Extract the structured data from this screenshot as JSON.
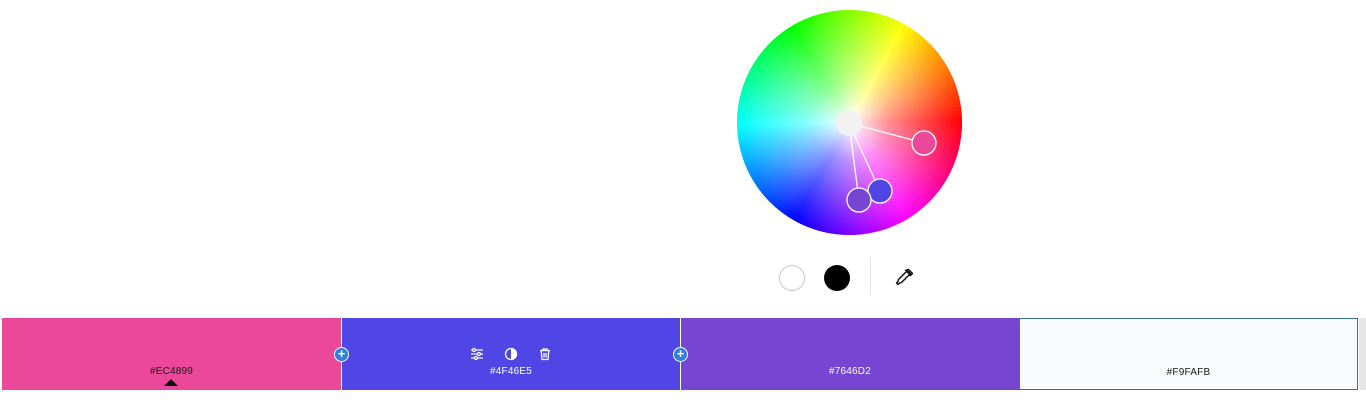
{
  "color_wheel": {
    "center_color": "#f2f2f2",
    "handles": [
      "#EC4899",
      "#4F46E5",
      "#7646D2"
    ]
  },
  "tools": {
    "white": "#FFFFFF",
    "black": "#000000",
    "eyedropper_icon": "eyedropper-icon"
  },
  "palette": {
    "swatches": [
      {
        "hex": "#EC4899",
        "color": "#EC4899",
        "selected": true
      },
      {
        "hex": "#4F46E5",
        "color": "#4F46E5",
        "actions": [
          "sliders-icon",
          "contrast-icon",
          "trash-icon"
        ]
      },
      {
        "hex": "#7646D2",
        "color": "#7646D2"
      },
      {
        "hex": "#F9FAFB",
        "color": "#F9FAFB"
      }
    ],
    "add_button_label": "+"
  }
}
